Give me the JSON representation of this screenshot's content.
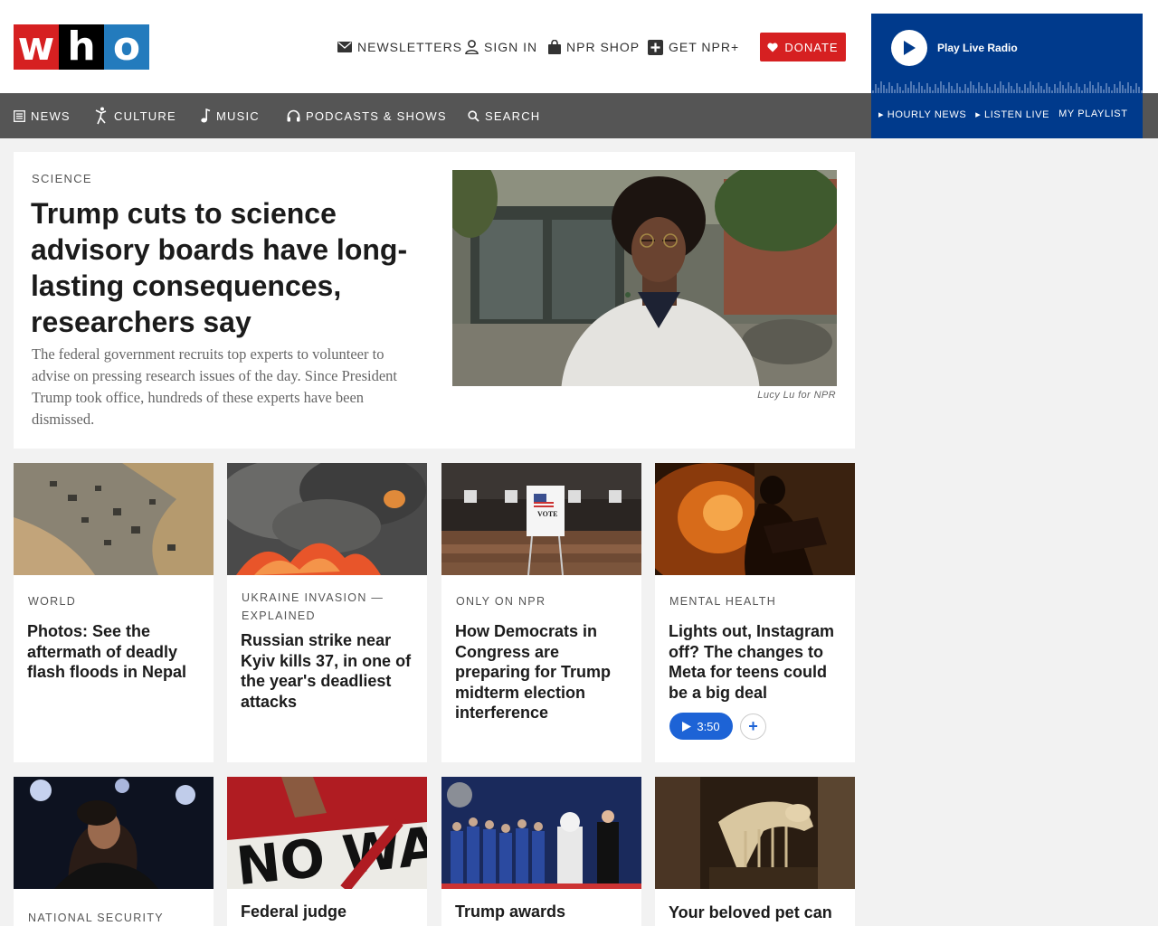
{
  "logo": {
    "letters": [
      "w",
      "h",
      "o"
    ],
    "colors": [
      "#d62021",
      "#000000",
      "#237bbd"
    ]
  },
  "utility": {
    "newsletters": "NEWSLETTERS",
    "sign_in": "SIGN IN",
    "shop": "NPR SHOP",
    "plus": "GET NPR+"
  },
  "donate": {
    "label": "DONATE",
    "color": "#d62021"
  },
  "radio": {
    "title": "Play Live Radio",
    "links": [
      "▸ HOURLY NEWS",
      "▸ LISTEN LIVE",
      "MY PLAYLIST"
    ],
    "color": "#003a8c"
  },
  "nav": {
    "items": [
      {
        "label": "NEWS",
        "icon": "newspaper-icon"
      },
      {
        "label": "CULTURE",
        "icon": "dancer-icon"
      },
      {
        "label": "MUSIC",
        "icon": "music-note-icon"
      },
      {
        "label": "PODCASTS & SHOWS",
        "icon": "headphones-icon"
      },
      {
        "label": "SEARCH",
        "icon": "search-icon"
      }
    ]
  },
  "featured": {
    "slug": "SCIENCE",
    "title": "Trump cuts to science advisory boards have long-lasting consequences, researchers say",
    "teaser": "The federal government recruits top experts to volunteer to advise on pressing research issues of the day. Since President Trump took office, hundreds of these experts have been dismissed.",
    "credit": "Lucy Lu for NPR"
  },
  "cards": [
    {
      "slug": "WORLD",
      "title": "Photos: See the aftermath of deadly flash floods in Nepal"
    },
    {
      "slug": "UKRAINE INVASION — EXPLAINED",
      "title": "Russian strike near Kyiv kills 37, in one of the year's deadliest attacks"
    },
    {
      "slug": "ONLY ON NPR",
      "title": "How Democrats in Congress are preparing for Trump midterm election interference"
    },
    {
      "slug": "MENTAL HEALTH",
      "title": "Lights out, Instagram off? The changes to Meta for teens could be a big deal",
      "audio": "3:50",
      "add": "+"
    }
  ],
  "cards2": [
    {
      "slug": "NATIONAL SECURITY",
      "title": ""
    },
    {
      "slug": "",
      "title": "Federal judge"
    },
    {
      "slug": "",
      "title": "Trump awards"
    },
    {
      "slug": "",
      "title": "Your beloved pet can"
    }
  ]
}
